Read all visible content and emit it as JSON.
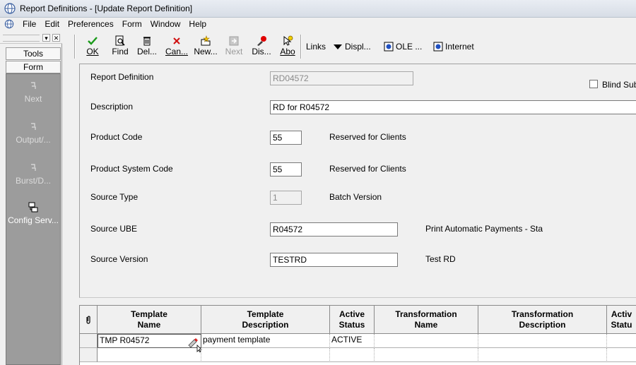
{
  "window": {
    "title": "Report Definitions - [Update Report Definition]"
  },
  "menu": [
    "File",
    "Edit",
    "Preferences",
    "Form",
    "Window",
    "Help"
  ],
  "sidebar": {
    "tabs": [
      "Tools",
      "Form"
    ],
    "actions": [
      {
        "label": "Next",
        "state": "disabled",
        "icon": "exit-icon"
      },
      {
        "label": "Output/...",
        "state": "disabled",
        "icon": "exit-icon"
      },
      {
        "label": "Burst/D...",
        "state": "disabled",
        "icon": "exit-icon"
      },
      {
        "label": "Config Serv...",
        "state": "enabled",
        "icon": "config-icon"
      }
    ]
  },
  "toolbar": {
    "ok": "OK",
    "find": "Find",
    "delete": "Del...",
    "cancel": "Can...",
    "new": "New...",
    "next": "Next",
    "display": "Dis...",
    "about": "Abo",
    "links": "Links",
    "display_menu": "Displ...",
    "ole": "OLE ...",
    "internet": "Internet"
  },
  "form": {
    "report_definition": {
      "label": "Report Definition",
      "value": "RD04572"
    },
    "blind_submission": {
      "label": "Blind Sub",
      "checked": false
    },
    "description": {
      "label": "Description",
      "value": "RD for R04572"
    },
    "product_code": {
      "label": "Product Code",
      "value": "55",
      "desc": "Reserved for Clients"
    },
    "product_system_code": {
      "label": "Product System Code",
      "value": "55",
      "desc": "Reserved for Clients"
    },
    "source_type": {
      "label": "Source Type",
      "value": "1",
      "desc": "Batch Version"
    },
    "source_ube": {
      "label": "Source UBE",
      "value": "R04572",
      "desc": "Print Automatic Payments - Sta"
    },
    "source_version": {
      "label": "Source Version",
      "value": "TESTRD",
      "desc": "Test RD"
    }
  },
  "grid": {
    "columns": [
      {
        "line1": "Template",
        "line2": "Name"
      },
      {
        "line1": "Template",
        "line2": "Description"
      },
      {
        "line1": "Active",
        "line2": "Status"
      },
      {
        "line1": "Transformation",
        "line2": "Name"
      },
      {
        "line1": "Transformation",
        "line2": "Description"
      },
      {
        "line1": "Activ",
        "line2": "Statu"
      }
    ],
    "rows": [
      {
        "template_name": "TMP R04572",
        "template_description": "payment template",
        "active_status": "ACTIVE",
        "transformation_name": "",
        "transformation_description": "",
        "active_status_2": ""
      }
    ]
  },
  "colors": {
    "sidebar_panel": "#9c9c9c",
    "ok_check": "#1a9a1a",
    "cancel_x": "#d01010"
  }
}
